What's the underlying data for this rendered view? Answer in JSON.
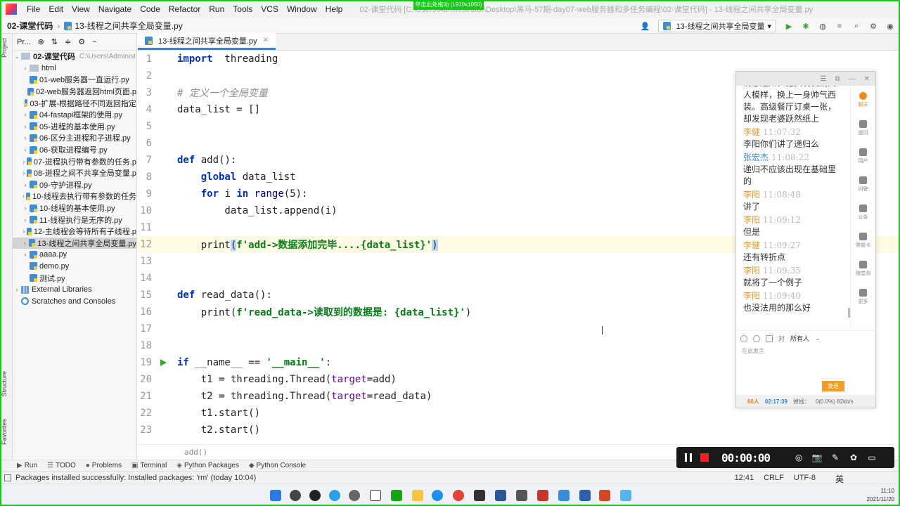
{
  "recording_banner": "单击此处拖动 (1910x1050)",
  "menu": [
    "File",
    "Edit",
    "View",
    "Navigate",
    "Code",
    "Refactor",
    "Run",
    "Tools",
    "VCS",
    "Window",
    "Help"
  ],
  "window_title": "02-课堂代码 [C:\\Users\\Administrator\\Desktop\\黑马-57期-day07-web服务器和多任务编程\\02-课堂代码] - 13-线程之间共享全局变量.py",
  "nav": {
    "root": "02-课堂代码",
    "file": "13-线程之间共享全局变量.py",
    "run_config": "13-线程之间共享全局变量"
  },
  "left_strip": {
    "project": "Project",
    "structure": "Structure",
    "favorites": "Favorites"
  },
  "project_panel": {
    "label": "Pr...",
    "root": "02-课堂代码",
    "root_path": "C:\\Users\\Administ",
    "items": [
      {
        "name": "html",
        "type": "folder",
        "expandable": true
      },
      {
        "name": "01-web服务器一直运行.py",
        "type": "py"
      },
      {
        "name": "02-web服务器返回html页面.p",
        "type": "py"
      },
      {
        "name": "03-扩展-根据路径不同返回指定",
        "type": "py"
      },
      {
        "name": "04-fastapi框架的使用.py",
        "type": "py",
        "expandable": true
      },
      {
        "name": "05-进程的基本使用.py",
        "type": "py",
        "expandable": true
      },
      {
        "name": "06-区分主进程和子进程.py",
        "type": "py",
        "expandable": true
      },
      {
        "name": "06-获取进程编号.py",
        "type": "py",
        "expandable": true
      },
      {
        "name": "07-进程执行带有参数的任务.p",
        "type": "py",
        "expandable": true
      },
      {
        "name": "08-进程之间不共享全局变量.p",
        "type": "py",
        "expandable": true
      },
      {
        "name": "09-守护进程.py",
        "type": "py",
        "expandable": true
      },
      {
        "name": "10-线程去执行带有参数的任务",
        "type": "py",
        "expandable": true
      },
      {
        "name": "10-线程的基本使用.py",
        "type": "py",
        "expandable": true
      },
      {
        "name": "11-线程执行是无序的.py",
        "type": "py",
        "expandable": true
      },
      {
        "name": "12-主线程会等待所有子线程.p",
        "type": "py",
        "expandable": true
      },
      {
        "name": "13-线程之间共享全局变量.py",
        "type": "py",
        "expandable": true,
        "selected": true
      },
      {
        "name": "aaaa.py",
        "type": "py",
        "expandable": true
      },
      {
        "name": "demo.py",
        "type": "py"
      },
      {
        "name": "测试.py",
        "type": "py"
      },
      {
        "name": "External Libraries",
        "type": "lib",
        "expandable": true
      },
      {
        "name": "Scratches and Consoles",
        "type": "scratch"
      }
    ]
  },
  "editor": {
    "tab": "13-线程之间共享全局变量.py",
    "current_line": 12,
    "run_line": 19,
    "breadcrumb": "add()"
  },
  "code": [
    {
      "n": "1",
      "parts": [
        [
          "kw",
          "import"
        ],
        [
          "",
          "  threading"
        ]
      ]
    },
    {
      "n": "2",
      "parts": []
    },
    {
      "n": "3",
      "parts": [
        [
          "cm",
          "# 定义一个全局变量"
        ]
      ]
    },
    {
      "n": "4",
      "parts": [
        [
          "",
          "data_list = []"
        ]
      ]
    },
    {
      "n": "5",
      "parts": []
    },
    {
      "n": "6",
      "parts": []
    },
    {
      "n": "7",
      "parts": [
        [
          "kw",
          "def"
        ],
        [
          "",
          " add():"
        ]
      ]
    },
    {
      "n": "8",
      "parts": [
        [
          "",
          "    "
        ],
        [
          "kw",
          "global"
        ],
        [
          "",
          " data_list"
        ]
      ]
    },
    {
      "n": "9",
      "parts": [
        [
          "",
          "    "
        ],
        [
          "kw",
          "for"
        ],
        [
          "",
          " i "
        ],
        [
          "kw",
          "in"
        ],
        [
          "",
          " "
        ],
        [
          "bi",
          "range"
        ],
        [
          "",
          "(5):"
        ]
      ]
    },
    {
      "n": "10",
      "parts": [
        [
          "",
          "        data_list.append(i)"
        ]
      ]
    },
    {
      "n": "11",
      "parts": []
    },
    {
      "n": "12",
      "parts": [
        [
          "",
          "    print"
        ],
        [
          "brk",
          "("
        ],
        [
          "str",
          "f'add->数据添加完毕....{data_list}'"
        ],
        [
          "brk",
          ")"
        ]
      ]
    },
    {
      "n": "13",
      "parts": []
    },
    {
      "n": "14",
      "parts": []
    },
    {
      "n": "15",
      "parts": [
        [
          "kw",
          "def"
        ],
        [
          "",
          " read_data():"
        ]
      ]
    },
    {
      "n": "16",
      "parts": [
        [
          "",
          "    print("
        ],
        [
          "str",
          "f'read_data->读取到的数据是: {data_list}'"
        ],
        [
          "",
          ")"
        ]
      ]
    },
    {
      "n": "17",
      "parts": []
    },
    {
      "n": "18",
      "parts": []
    },
    {
      "n": "19",
      "parts": [
        [
          "kw",
          "if"
        ],
        [
          "",
          " __name__ == "
        ],
        [
          "str",
          "'__main__'"
        ],
        [
          "",
          ":"
        ]
      ]
    },
    {
      "n": "20",
      "parts": [
        [
          "",
          "    t1 = threading.Thread("
        ],
        [
          "kwarg",
          "target"
        ],
        [
          "",
          "=add)"
        ]
      ]
    },
    {
      "n": "21",
      "parts": [
        [
          "",
          "    t2 = threading.Thread("
        ],
        [
          "kwarg",
          "target"
        ],
        [
          "",
          "=read_data)"
        ]
      ]
    },
    {
      "n": "22",
      "parts": [
        [
          "",
          "    t1.start()"
        ]
      ]
    },
    {
      "n": "23",
      "parts": [
        [
          "",
          "    t2.start()"
        ]
      ]
    }
  ],
  "bottom_tools": [
    "Run",
    "TODO",
    "Problems",
    "Terminal",
    "Python Packages",
    "Python Console"
  ],
  "status": {
    "message": "Packages installed successfully: Installed packages: 'rm' (today 10:04)",
    "position": "12:41",
    "line_sep": "CRLF",
    "encoding": "UTF-8"
  },
  "recorder": {
    "timer": "00:00:00"
  },
  "chat": {
    "intro_text": "消息通知，把头发梳成大人模样，换上一身帅气西装。高级餐厅订桌一张，却发现老婆跃然纸上",
    "messages": [
      {
        "name": "李健",
        "time": "11:07:32",
        "text": "李阳你们讲了递归么",
        "color": "orange"
      },
      {
        "name": "张宏杰",
        "time": "11:08:22",
        "text": "递归不应该出现在基础里的",
        "color": "blue"
      },
      {
        "name": "李阳",
        "time": "11:08:48",
        "text": "讲了",
        "color": "orange"
      },
      {
        "name": "李阳",
        "time": "11:09:12",
        "text": "但是",
        "color": "orange"
      },
      {
        "name": "李健",
        "time": "11:09:27",
        "text": "还有转折点",
        "color": "orange"
      },
      {
        "name": "李阳",
        "time": "11:09:35",
        "text": "就将了一个例子",
        "color": "orange"
      },
      {
        "name": "李阳",
        "time": "11:09:40",
        "text": "也没法用的那么好",
        "color": "orange"
      }
    ],
    "side": [
      "聊天",
      "提问",
      "用户",
      "问答",
      "公告",
      "答题卡",
      "随堂测",
      "更多"
    ],
    "recipient": "所有人",
    "placeholder": "在此发言",
    "send": "发送",
    "footer": {
      "count": "60人",
      "time": "02:17:39",
      "net": "0(0.0%) 82kb/s",
      "net_label": "掉线："
    }
  },
  "tray": {
    "time": "11:10",
    "date": "2021/11/20",
    "ime": "英"
  }
}
